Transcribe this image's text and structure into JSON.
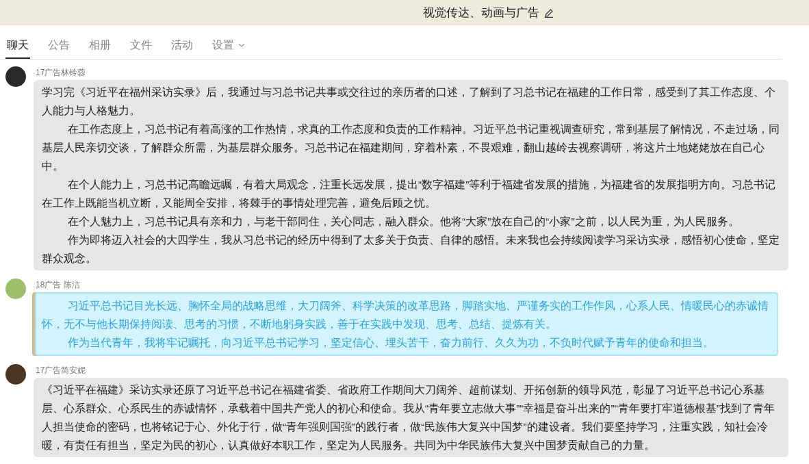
{
  "header": {
    "title": "视觉传达、动画与广告"
  },
  "tabs": [
    {
      "label": "聊天",
      "selected": true,
      "kind": "tab"
    },
    {
      "label": "公告",
      "selected": false,
      "kind": "tab"
    },
    {
      "label": "相册",
      "selected": false,
      "kind": "tab"
    },
    {
      "label": "文件",
      "selected": false,
      "kind": "tab"
    },
    {
      "label": "活动",
      "selected": false,
      "kind": "tab"
    },
    {
      "label": "设置",
      "selected": false,
      "kind": "dropdown"
    }
  ],
  "messages": [
    {
      "sender": "17广告林铃蓉",
      "kind": "plain",
      "paragraphs": [
        {
          "text": "学习完《习近平在福州采访实录》后，我通过与习总书记共事或交往过的亲历者的口述，了解到了习总书记在福建的工作日常，感受到了其工作态度、个人能力与人格魅力。",
          "indented": false
        },
        {
          "text": "在工作态度上，习总书记有着高涨的工作热情，求真的工作态度和负责的工作精神。习近平总书记重视调查研究，常到基层了解情况，不走过场，同基层人民亲切交谈，了解群众所需，为基层群众服务。习总书记在福建期间，穿着朴素，不畏艰难，翻山越岭去视察调研，将这片土地姥姥放在自己心中。",
          "indented": true
        },
        {
          "text": "在个人能力上，习总书记高瞻远瞩，有着大局观念，注重长远发展，提出“数字福建”等利于福建省发展的措施，为福建省的发展指明方向。习总书记在工作上既能当机立断，又能周全安排，将棘手的事情处理完善，避免后顾之忧。",
          "indented": true
        },
        {
          "text": "在个人魅力上，习总书记具有亲和力，与老干部同住，关心同志，融入群众。他将“大家”放在自己的“小家”之前，以人民为重，为人民服务。",
          "indented": true
        },
        {
          "text": "作为即将迈入社会的大四学生，我从习总书记的经历中得到了太多关于负责、自律的感悟。未来我也会持续阅读学习采访实录，感悟初心使命，坚定群众观念。",
          "indented": true
        }
      ]
    },
    {
      "sender": "18广告 陈洁",
      "kind": "bubble",
      "paragraphs": [
        {
          "text": "习近平总书记目光长远、胸怀全局的战略思维，大刀阔斧、科学决策的改革思路，脚踏实地、严谨务实的工作作风，心系人民、情暖民心的赤诚情怀，无不与他长期保持阅读、思考的习惯，不断地躬身实践，善于在实践中发现、思考、总结、提炼有关。",
          "indented": true
        },
        {
          "text": "作为当代青年，我将牢记嘱托，向习近平总书记学习，坚定信心、埋头苦干，奋力前行、久久为功，不负时代赋予青年的使命和担当。",
          "indented": true
        }
      ]
    },
    {
      "sender": "17广告简安妮",
      "kind": "plain",
      "paragraphs": [
        {
          "text": "《习近平在福建》采访实录还原了习近平总书记在福建省委、省政府工作期间大刀阔斧、超前谋划、开拓创新的领导风范，彰显了习近平总书记心系基层、心系群众、心系民生的赤诚情怀，承载着中国共产党人的初心和使命。我从“青年要立志做大事”“幸福是奋斗出来的”“青年要打牢道德根基”找到了青年人担当使命的密码，也将铭记于心、外化于行，做“青年强则国强”的践行者，做“民族伟大复兴中国梦”的建设者。我们要坚持学习，注重实践，知社会冷暖，有责任有担当，坚定为民的初心，认真做好本职工作，坚定为人民服务。共同为中华民族伟大复兴中国梦贡献自己的力量。",
          "indented": false
        }
      ]
    }
  ]
}
